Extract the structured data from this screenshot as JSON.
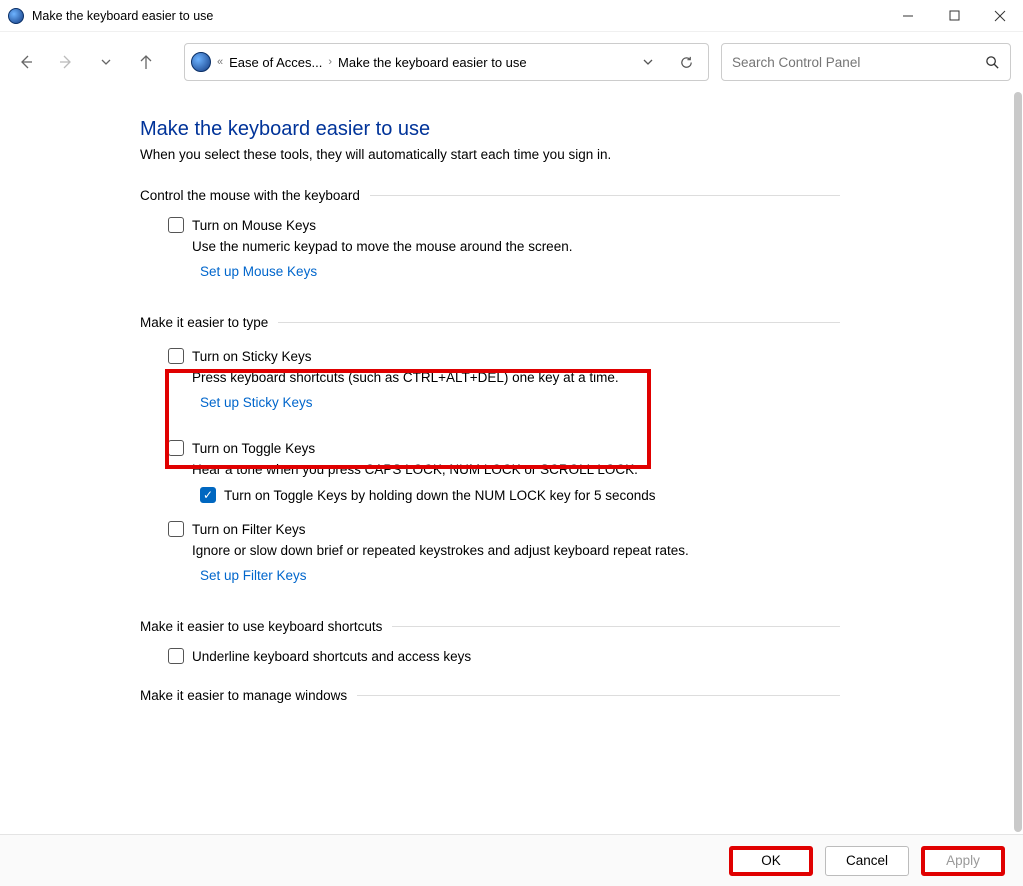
{
  "window": {
    "title": "Make the keyboard easier to use"
  },
  "breadcrumb": {
    "crumb1": "Ease of Acces...",
    "crumb2": "Make the keyboard easier to use"
  },
  "search": {
    "placeholder": "Search Control Panel"
  },
  "page": {
    "heading": "Make the keyboard easier to use",
    "subtitle": "When you select these tools, they will automatically start each time you sign in."
  },
  "sections": {
    "mouse_control": {
      "title": "Control the mouse with the keyboard",
      "mouse_keys_label": "Turn on Mouse Keys",
      "mouse_keys_desc": "Use the numeric keypad to move the mouse around the screen.",
      "mouse_keys_link": "Set up Mouse Keys"
    },
    "typing": {
      "title": "Make it easier to type",
      "sticky_label": "Turn on Sticky Keys",
      "sticky_desc": "Press keyboard shortcuts (such as CTRL+ALT+DEL) one key at a time.",
      "sticky_link": "Set up Sticky Keys",
      "toggle_label": "Turn on Toggle Keys",
      "toggle_desc": "Hear a tone when you press CAPS LOCK, NUM LOCK or SCROLL LOCK.",
      "toggle_numlock_label": "Turn on Toggle Keys by holding down the NUM LOCK key for 5 seconds",
      "filter_label": "Turn on Filter Keys",
      "filter_desc": "Ignore or slow down brief or repeated keystrokes and adjust keyboard repeat rates.",
      "filter_link": "Set up Filter Keys"
    },
    "shortcuts": {
      "title": "Make it easier to use keyboard shortcuts",
      "underline_label": "Underline keyboard shortcuts and access keys"
    },
    "windows": {
      "title": "Make it easier to manage windows"
    }
  },
  "footer": {
    "ok": "OK",
    "cancel": "Cancel",
    "apply": "Apply"
  }
}
